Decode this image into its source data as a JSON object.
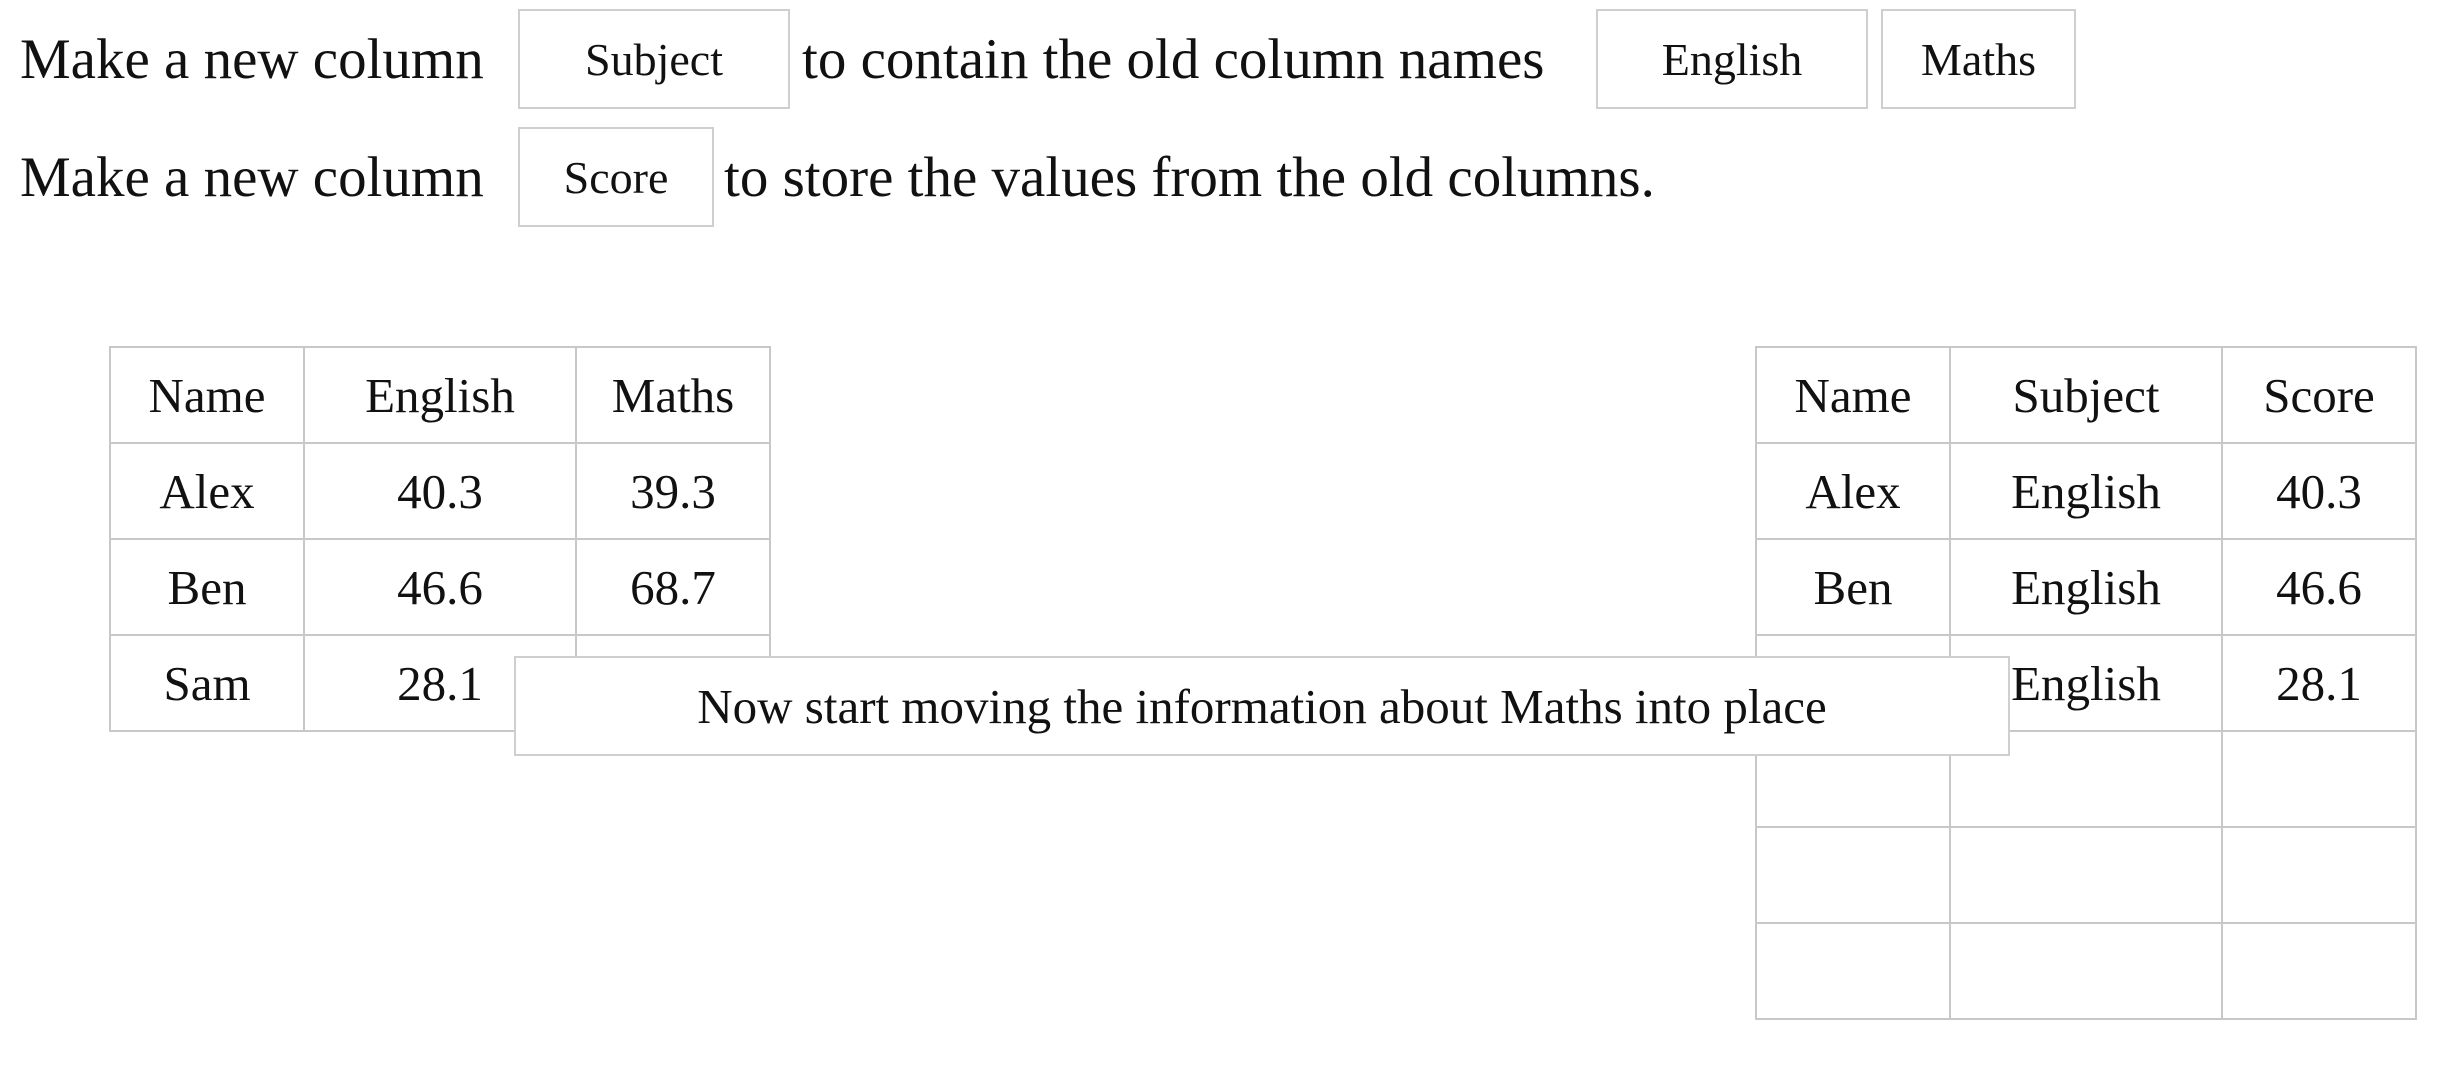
{
  "instructions": {
    "line1": {
      "prefix": "Make a new column",
      "chip_subject": "Subject",
      "middle": "to contain the old column names",
      "chip_english": "English",
      "chip_maths": "Maths"
    },
    "line2": {
      "prefix": "Make a new column",
      "chip_score": "Score",
      "suffix": "to store the values from the old columns."
    }
  },
  "left_table": {
    "headers": [
      "Name",
      "English",
      "Maths"
    ],
    "rows": [
      [
        "Alex",
        "40.3",
        "39.3"
      ],
      [
        "Ben",
        "46.6",
        "68.7"
      ],
      [
        "Sam",
        "28.1",
        ""
      ]
    ]
  },
  "right_table": {
    "headers": [
      "Name",
      "Subject",
      "Score"
    ],
    "rows": [
      [
        "Alex",
        "English",
        "40.3"
      ],
      [
        "Ben",
        "English",
        "46.6"
      ],
      [
        "",
        "English",
        "28.1"
      ],
      [
        "",
        "",
        ""
      ],
      [
        "",
        "",
        ""
      ],
      [
        "",
        "",
        ""
      ]
    ]
  },
  "message": "Now start moving the information about Maths into place"
}
